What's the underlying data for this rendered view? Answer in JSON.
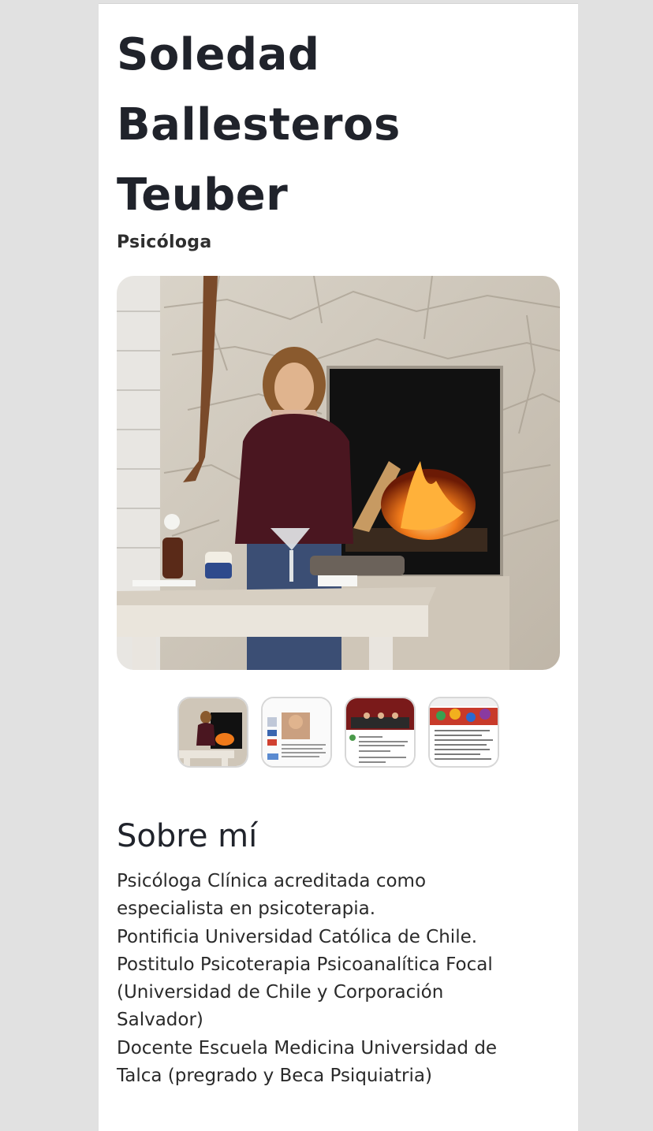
{
  "profile": {
    "name_lines": [
      "Soledad",
      "Ballesteros",
      "Teuber"
    ],
    "role": "Psicóloga"
  },
  "gallery": {
    "main_photo": "profile-photo",
    "thumbnail_count": 4,
    "thumbnails": [
      {
        "name": "thumbnail-profile-photo",
        "selected": true
      },
      {
        "name": "thumbnail-article-screenshot",
        "selected": false
      },
      {
        "name": "thumbnail-news-article",
        "selected": false
      },
      {
        "name": "thumbnail-research-page",
        "selected": false
      }
    ]
  },
  "about": {
    "title": "Sobre mí",
    "lines": [
      "Psicóloga Clínica acreditada como",
      "especialista en psicoterapia.",
      "Pontificia Universidad Católica de Chile.",
      "Postitulo Psicoterapia Psicoanalítica Focal",
      "(Universidad de Chile y Corporación",
      "Salvador)",
      "Docente Escuela Medicina Universidad de",
      "Talca (pregrado y Beca Psiquiatria)"
    ]
  },
  "colors": {
    "page_background": "#e1e1e1",
    "card_background": "#ffffff",
    "heading": "#20232b"
  }
}
